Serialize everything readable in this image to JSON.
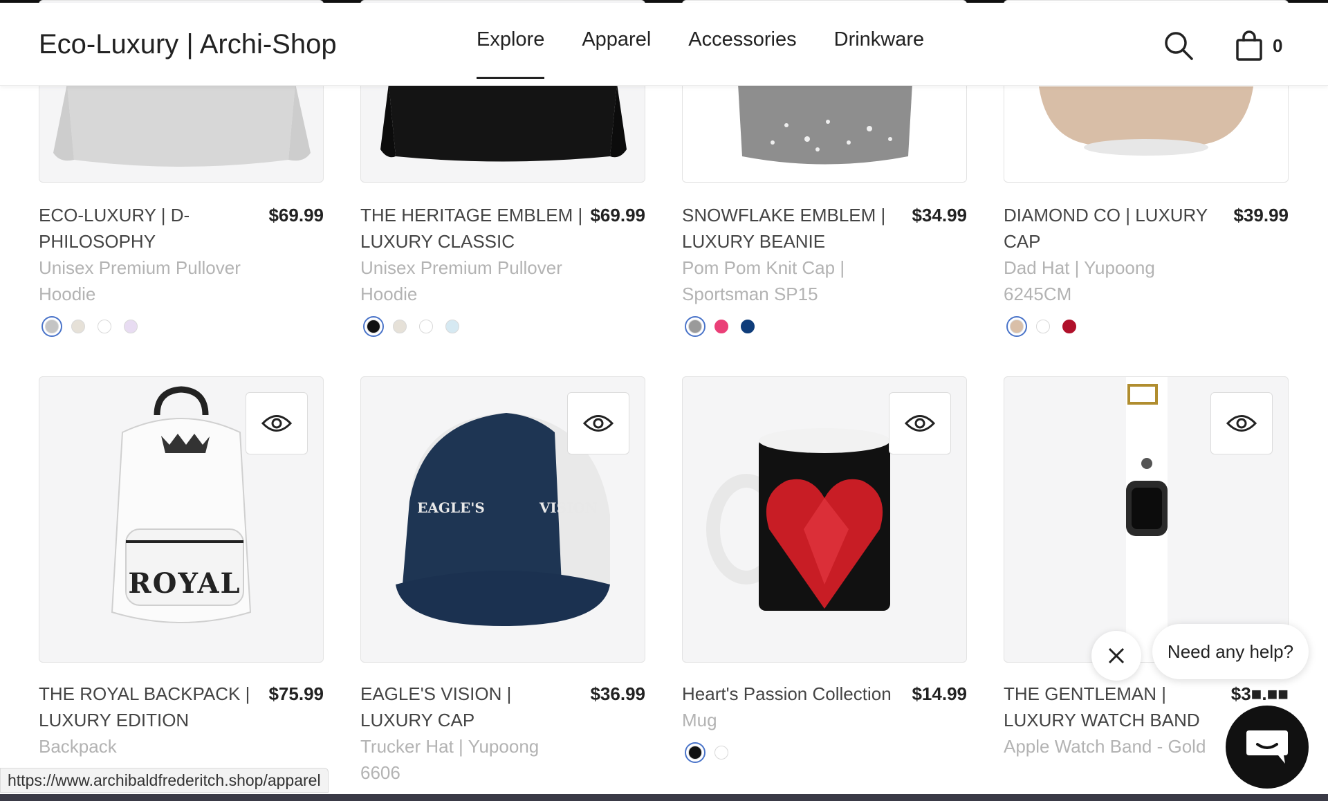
{
  "header": {
    "brand": "Eco-Luxury | Archi-Shop",
    "nav": [
      "Explore",
      "Apparel",
      "Accessories",
      "Drinkware"
    ],
    "active_nav": "Explore",
    "cart_count": "0"
  },
  "products_row1": [
    {
      "title": "ECO-LUXURY | D-PHILOSOPHY",
      "price": "$69.99",
      "sub": "Unisex Premium Pullover Hoodie",
      "swatches": [
        "#c4c4c4",
        "#e6e1d8",
        "#ffffff",
        "#e8dcf2"
      ]
    },
    {
      "title": "THE HERITAGE EMBLEM | LUXURY CLASSIC",
      "price": "$69.99",
      "sub": "Unisex Premium Pullover Hoodie",
      "swatches": [
        "#111111",
        "#e6e1d8",
        "#ffffff",
        "#d6e9f2"
      ]
    },
    {
      "title": "SNOWFLAKE EMBLEM | LUXURY BEANIE",
      "price": "$34.99",
      "sub": "Pom Pom Knit Cap | Sportsman SP15",
      "swatches": [
        "#9a9a9a",
        "#ea3f77",
        "#0f3d7a"
      ]
    },
    {
      "title": "DIAMOND CO | LUXURY CAP",
      "price": "$39.99",
      "sub": "Dad Hat | Yupoong 6245CM",
      "swatches": [
        "#d9bfa8",
        "#ffffff",
        "#b0102a"
      ]
    }
  ],
  "products_row2": [
    {
      "title": "THE ROYAL BACKPACK | LUXURY EDITION",
      "price": "$75.99",
      "sub": "Backpack",
      "print": "ROYAL"
    },
    {
      "title": "EAGLE'S VISION | LUXURY CAP",
      "price": "$36.99",
      "sub": "Trucker Hat | Yupoong 6606",
      "print_left": "EAGLE'S",
      "print_right": "VISION"
    },
    {
      "title": "Heart's Passion Collection",
      "price": "$14.99",
      "sub": "Mug",
      "swatches": [
        "#111111",
        "#ffffff"
      ]
    },
    {
      "title": "THE GENTLEMAN | LUXURY WATCH BAND",
      "price": "$3■.■■",
      "sub": "Apple Watch Band - Gold"
    }
  ],
  "chat": {
    "prompt": "Need any help?"
  },
  "status_url": "https://www.archibaldfrederitch.shop/apparel",
  "colors": {
    "selected_ring": "#4a74c9",
    "subtitle": "#b3b3b3",
    "launcher": "#111111"
  },
  "icons": [
    "search-icon",
    "cart-icon",
    "eye-icon",
    "close-icon",
    "chat-icon"
  ]
}
